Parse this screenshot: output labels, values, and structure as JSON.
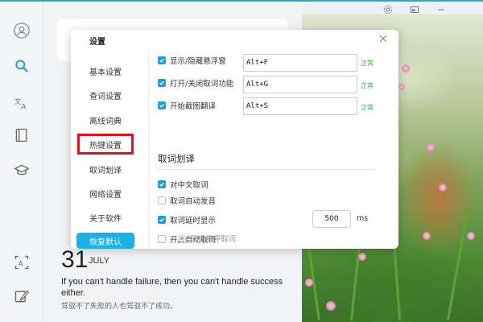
{
  "dialog": {
    "title": "设置",
    "nav": [
      "基本设置",
      "查词设置",
      "离线词典",
      "热键设置",
      "取词划译",
      "网络设置",
      "关于软件"
    ],
    "active_index": 3,
    "restore_label": "恢复默认"
  },
  "hotkeys": [
    {
      "label": "显示/隐藏悬浮窗",
      "key": "Alt+F",
      "status": "正常",
      "checked": true
    },
    {
      "label": "打开/关闭取词功能",
      "key": "Alt+G",
      "status": "正常",
      "checked": true
    },
    {
      "label": "开始截图翻译",
      "key": "Alt+S",
      "status": "正常",
      "checked": true
    }
  ],
  "section": {
    "title": "取词划译",
    "options": [
      {
        "label": "对中文取词",
        "checked": true
      },
      {
        "label": "取词自动发音",
        "checked": false
      },
      {
        "label": "取词延时显示",
        "checked": true
      },
      {
        "label": "开启自动取词",
        "checked": false
      }
    ],
    "delay_value": "500",
    "delay_unit": "ms",
    "radio_label": "鼠标悬停取词"
  },
  "daily": {
    "day": "31",
    "month": "JULY",
    "quote_en": "If you can't handle failure, then you can't handle success either.",
    "quote_zh": "驾驭不了失败的人也驾驭不了成功。"
  },
  "icons": {
    "sidebar": [
      "avatar-icon",
      "search-icon",
      "translate-icon",
      "book-icon",
      "graduation-cap-icon",
      "screenshot-translate-icon",
      "pen-edit-icon"
    ],
    "window": [
      "gear-icon",
      "mini-mode-icon",
      "minimize-icon"
    ]
  },
  "colors": {
    "accent": "#1bb0e6",
    "checkbox": "#1f9ed8",
    "status_ok": "#2db54b",
    "highlight_box": "#e0101f"
  }
}
